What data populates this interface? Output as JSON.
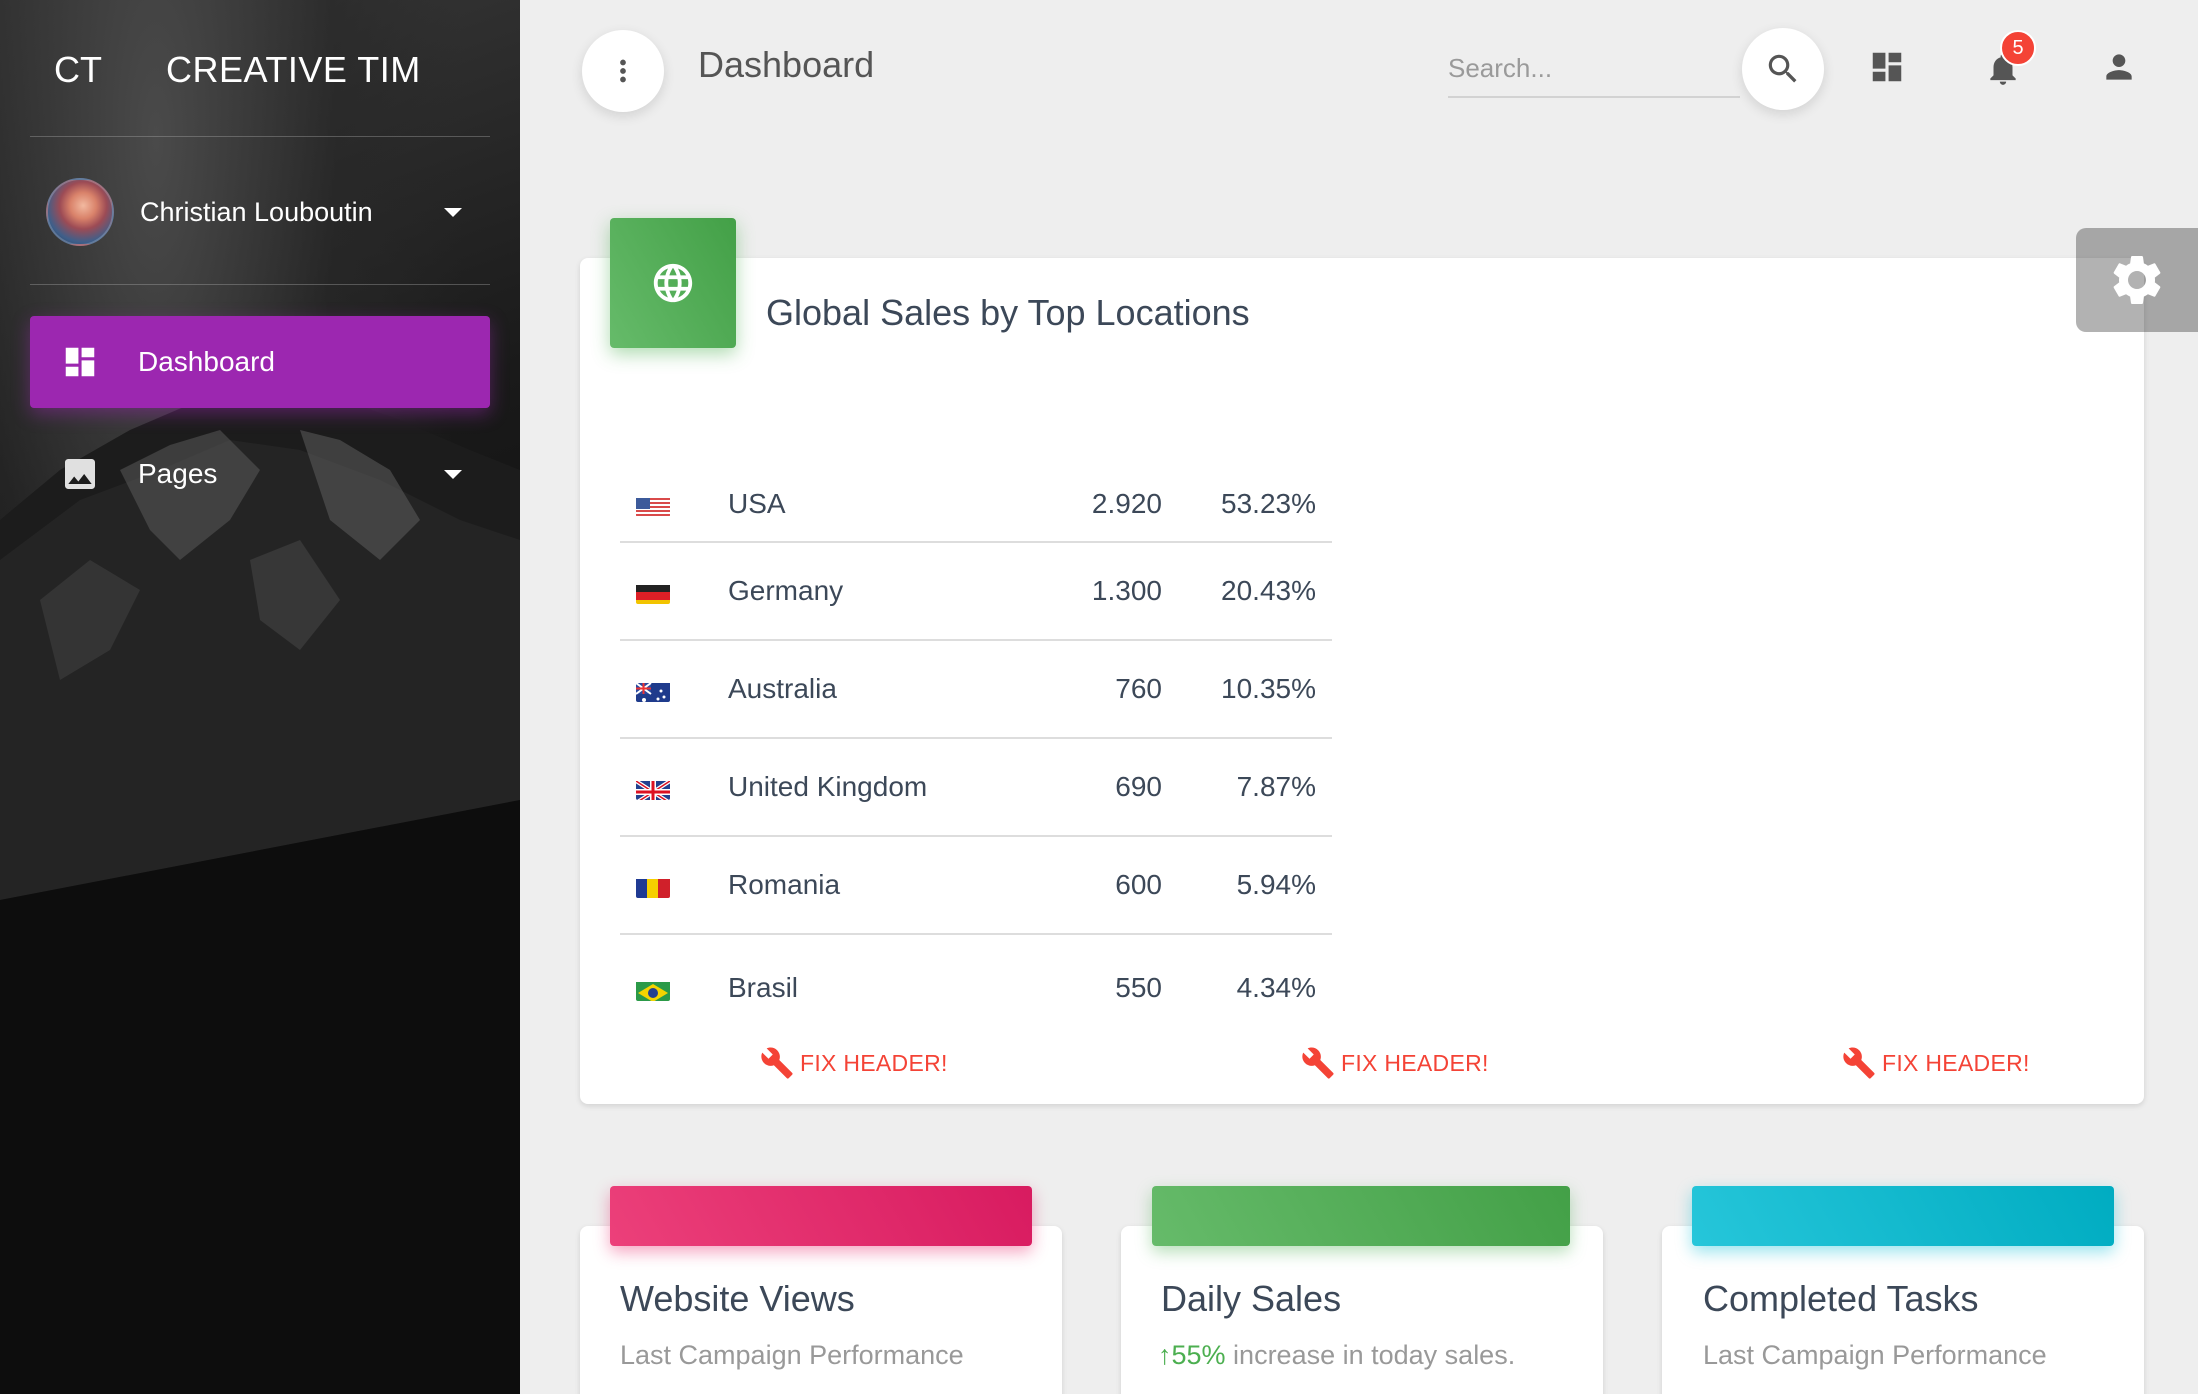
{
  "brand": {
    "mini": "CT",
    "full": "CREATIVE TIM"
  },
  "user": {
    "name": "Christian Louboutin"
  },
  "sidebar": {
    "items": [
      {
        "label": "Dashboard",
        "icon": "dashboard-icon",
        "active": true
      },
      {
        "label": "Pages",
        "icon": "image-icon",
        "active": false
      }
    ]
  },
  "navbar": {
    "title": "Dashboard",
    "search_placeholder": "Search...",
    "notifications_count": "5"
  },
  "sales_card": {
    "title": "Global Sales by Top Locations",
    "rows": [
      {
        "country": "USA",
        "flag": "us-flag-icon",
        "sales": "2.920",
        "percent": "53.23%"
      },
      {
        "country": "Germany",
        "flag": "de-flag-icon",
        "sales": "1.300",
        "percent": "20.43%"
      },
      {
        "country": "Australia",
        "flag": "au-flag-icon",
        "sales": "760",
        "percent": "10.35%"
      },
      {
        "country": "United Kingdom",
        "flag": "gb-flag-icon",
        "sales": "690",
        "percent": "7.87%"
      },
      {
        "country": "Romania",
        "flag": "ro-flag-icon",
        "sales": "600",
        "percent": "5.94%"
      },
      {
        "country": "Brasil",
        "flag": "br-flag-icon",
        "sales": "550",
        "percent": "4.34%"
      }
    ],
    "fix_labels": [
      "FIX HEADER!",
      "FIX HEADER!",
      "FIX HEADER!"
    ]
  },
  "bottom_cards": [
    {
      "title": "Website Views",
      "subtitle": "Last Campaign Performance",
      "color": "#e91e63"
    },
    {
      "title": "Daily Sales",
      "subtitle_highlight": "55%",
      "subtitle_rest": " increase in today sales.",
      "color": "#4caf50"
    },
    {
      "title": "Completed Tasks",
      "subtitle": "Last Campaign Performance",
      "color": "#00bcd4"
    }
  ],
  "colors": {
    "active_nav": "#9c27b0",
    "card_icon": "#4caf50",
    "danger": "#f44336"
  }
}
